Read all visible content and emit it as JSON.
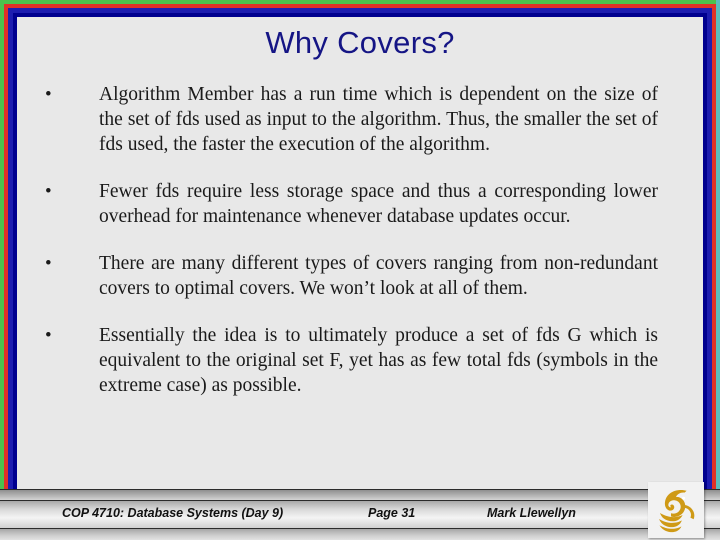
{
  "slide": {
    "title": "Why Covers?",
    "bullet_marker": "•",
    "bullets": [
      {
        "text": "Algorithm Member has a run time which is dependent on the size of the set of fds used as input to the algorithm.  Thus, the smaller the set of fds used, the faster the execution of the algorithm."
      },
      {
        "text": "Fewer fds require less storage space and thus a corresponding lower overhead for maintenance whenever database updates occur."
      },
      {
        "text": "There are many different types of covers ranging from non-redundant covers to optimal covers.  We won’t look at all of them."
      },
      {
        "text": "Essentially the idea is to ultimately produce a set of fds G which is equivalent to the original set F, yet has as few total fds (symbols in the extreme case) as possible."
      }
    ]
  },
  "footer": {
    "course": "COP 4710: Database Systems  (Day 9)",
    "page": "Page 31",
    "author": "Mark Llewellyn",
    "logo_name": "ucf-pegasus-logo"
  },
  "colors": {
    "frame_green": "#4cc24c",
    "frame_red": "#e03127",
    "frame_teal": "#5bbdbd",
    "frame_navy": "#1d1db0",
    "frame_navy_inner": "#00008f",
    "slide_background": "#e8e8e8",
    "title_color": "#151585",
    "body_text": "#1a1a1a",
    "logo_gold": "#cf9a16"
  }
}
